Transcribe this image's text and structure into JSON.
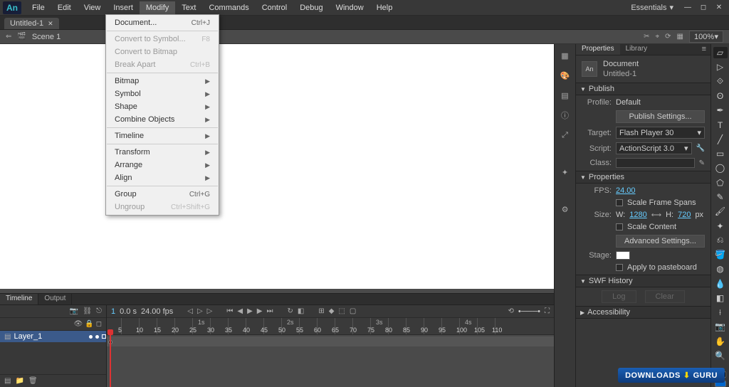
{
  "menubar": {
    "items": [
      "File",
      "Edit",
      "View",
      "Insert",
      "Modify",
      "Text",
      "Commands",
      "Control",
      "Debug",
      "Window",
      "Help"
    ],
    "workspace": "Essentials"
  },
  "doc_tab": {
    "name": "Untitled-1"
  },
  "edit_bar": {
    "scene": "Scene 1",
    "zoom": "100%"
  },
  "modify_menu": {
    "document": "Document...",
    "document_sc": "Ctrl+J",
    "convert_symbol": "Convert to Symbol...",
    "convert_symbol_sc": "F8",
    "convert_bitmap": "Convert to Bitmap",
    "break_apart": "Break Apart",
    "break_apart_sc": "Ctrl+B",
    "bitmap": "Bitmap",
    "symbol": "Symbol",
    "shape": "Shape",
    "combine": "Combine Objects",
    "timeline": "Timeline",
    "transform": "Transform",
    "arrange": "Arrange",
    "align": "Align",
    "group": "Group",
    "group_sc": "Ctrl+G",
    "ungroup": "Ungroup",
    "ungroup_sc": "Ctrl+Shift+G"
  },
  "timeline": {
    "tab1": "Timeline",
    "tab2": "Output",
    "frame": "1",
    "time": "0.0 s",
    "fps": "24.00 fps",
    "layer": "Layer_1",
    "seconds": [
      "1s",
      "2s",
      "3s",
      "4s"
    ],
    "frames": [
      "5",
      "10",
      "15",
      "20",
      "25",
      "30",
      "35",
      "40",
      "45",
      "50",
      "55",
      "60",
      "65",
      "70",
      "75",
      "80",
      "85",
      "90",
      "95",
      "100",
      "105",
      "110"
    ]
  },
  "props": {
    "tab_props": "Properties",
    "tab_lib": "Library",
    "doc_label": "Document",
    "doc_name": "Untitled-1",
    "sec_publish": "Publish",
    "profile_lbl": "Profile:",
    "profile_val": "Default",
    "publish_btn": "Publish Settings...",
    "target_lbl": "Target:",
    "target_val": "Flash Player 30",
    "script_lbl": "Script:",
    "script_val": "ActionScript 3.0",
    "class_lbl": "Class:",
    "sec_properties": "Properties",
    "fps_lbl": "FPS:",
    "fps_val": "24.00",
    "scale_spans": "Scale Frame Spans",
    "size_lbl": "Size:",
    "w_lbl": "W:",
    "w_val": "1280",
    "h_lbl": "H:",
    "h_val": "720",
    "px": "px",
    "scale_content": "Scale Content",
    "advanced_btn": "Advanced Settings...",
    "stage_lbl": "Stage:",
    "apply_paste": "Apply to pasteboard",
    "sec_swf": "SWF History",
    "swf_log": "Log",
    "swf_clear": "Clear",
    "sec_acc": "Accessibility"
  },
  "watermark": {
    "a": "DOWNLOADS",
    "b": "GURU"
  }
}
